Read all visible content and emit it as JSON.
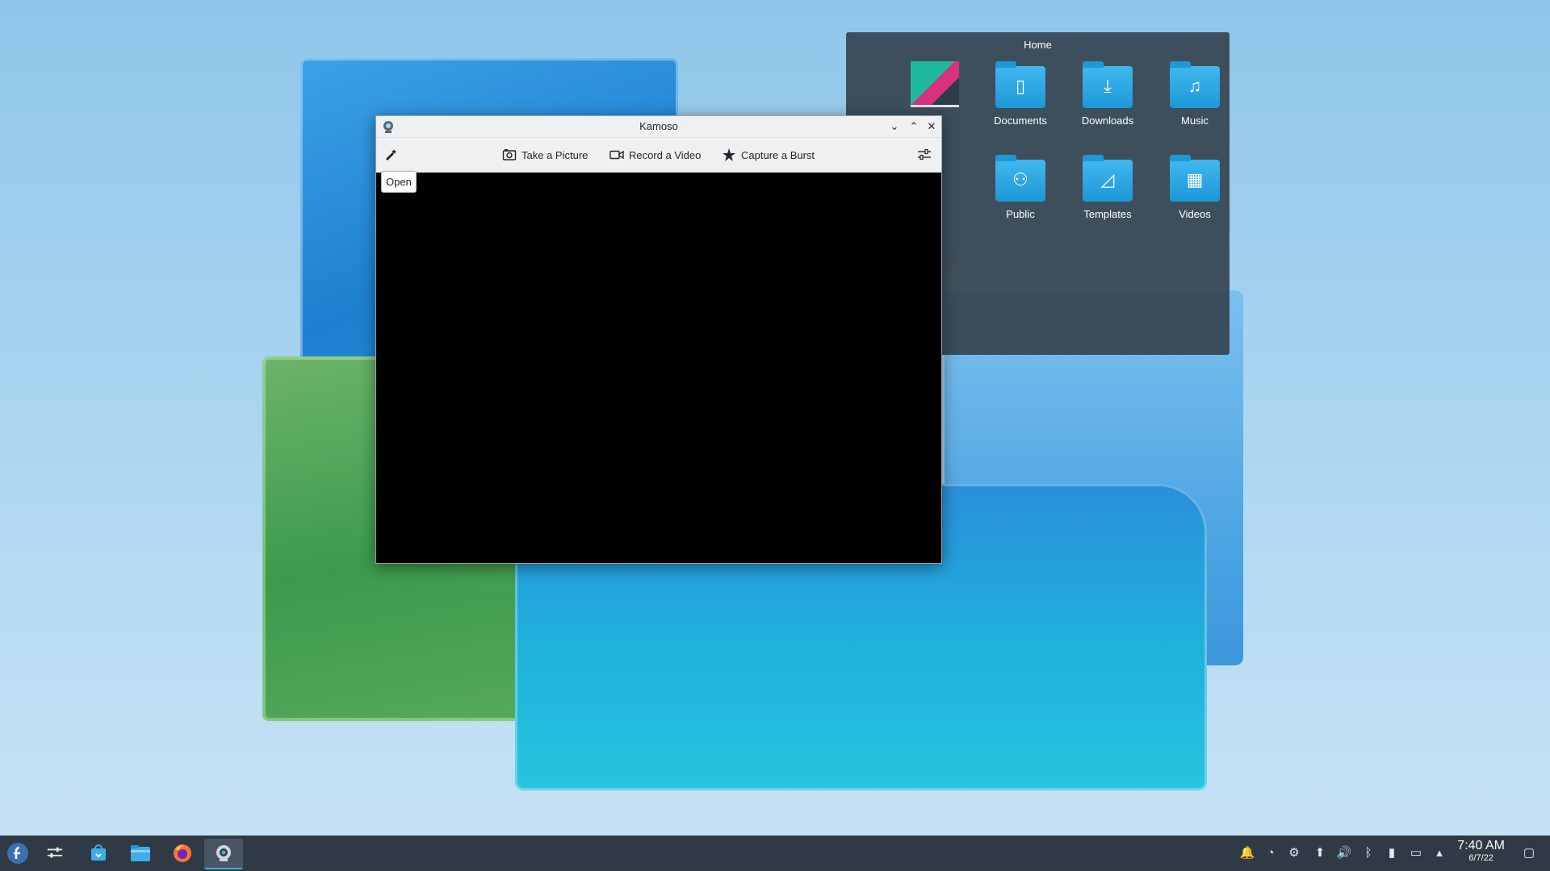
{
  "desktop": {
    "folder_view": {
      "title": "Home",
      "items": [
        {
          "label": "",
          "icon": "image-thumbnail-icon"
        },
        {
          "label": "Documents",
          "icon": "documents-folder-icon",
          "glyph": "▯"
        },
        {
          "label": "Downloads",
          "icon": "downloads-folder-icon",
          "glyph": "⤓"
        },
        {
          "label": "Music",
          "icon": "music-folder-icon",
          "glyph": "♫"
        },
        {
          "label": "Public",
          "icon": "public-folder-icon",
          "glyph": "⚇"
        },
        {
          "label": "Templates",
          "icon": "templates-folder-icon",
          "glyph": "◿"
        },
        {
          "label": "Videos",
          "icon": "videos-folder-icon",
          "glyph": "▦"
        }
      ]
    }
  },
  "window": {
    "title": "Kamoso",
    "controls": {
      "minimize": "⌄",
      "maximize": "⌃",
      "close": "✕"
    },
    "toolbar": {
      "open_tooltip": "Open",
      "take_picture": "Take a Picture",
      "record_video": "Record a Video",
      "capture_burst": "Capture a Burst"
    }
  },
  "taskbar": {
    "clock": {
      "time": "7:40 AM",
      "date": "6/7/22"
    }
  },
  "colors": {
    "accent": "#3daee9",
    "panel": "#2f3a44",
    "window_bg": "#eff0f1"
  }
}
